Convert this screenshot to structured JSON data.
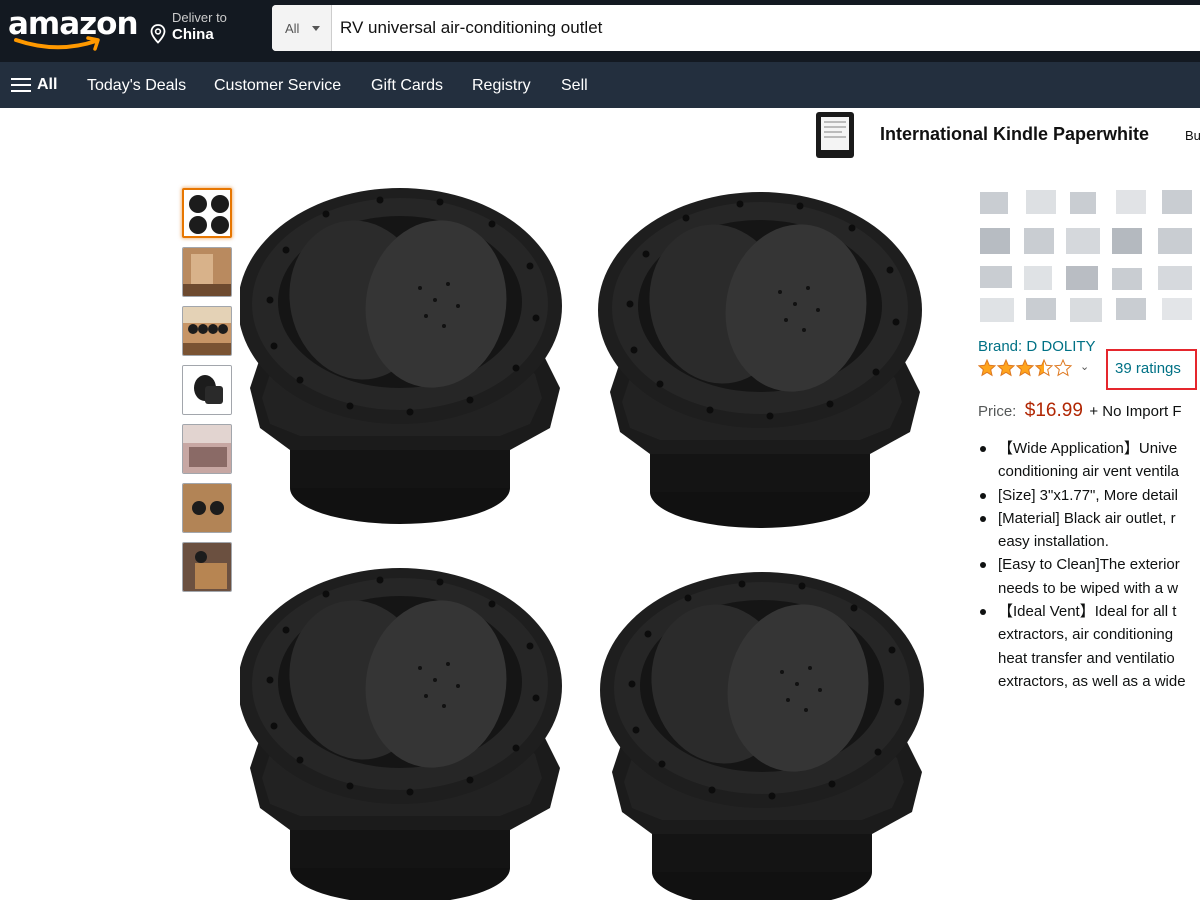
{
  "header": {
    "logo_text": "amazon",
    "deliver_label": "Deliver to",
    "deliver_location": "China",
    "search_category": "All",
    "search_value": "RV universal air-conditioning outlet"
  },
  "subnav": {
    "all_label": "All",
    "items": [
      "Today's Deals",
      "Customer Service",
      "Gift Cards",
      "Registry",
      "Sell"
    ]
  },
  "banner": {
    "title": "International Kindle Paperwhite",
    "more": "Bu"
  },
  "product": {
    "brand": "Brand: D DOLITY",
    "rating_stars": 4,
    "ratings_count": "39 ratings",
    "price_label": "Price:",
    "price": "$16.99",
    "price_note": "+ No Import F",
    "thumbnail_count": 7,
    "bullets": [
      [
        "【Wide Application】Unive",
        "conditioning air vent ventila"
      ],
      [
        "[Size] 3\"x1.77\", More detail"
      ],
      [
        "[Material] Black air outlet, r",
        "easy installation."
      ],
      [
        "[Easy to Clean]The exterior",
        "needs to be wiped with a w"
      ],
      [
        "【Ideal Vent】Ideal for all t",
        "extractors, air conditioning",
        "heat transfer and ventilatio",
        "extractors, as well as a wide"
      ]
    ]
  },
  "colors": {
    "nav_dark": "#131921",
    "nav_sub": "#232f3e",
    "link": "#007185",
    "price": "#b12704",
    "highlight": "#e5262d",
    "star": "#ffa41c"
  }
}
